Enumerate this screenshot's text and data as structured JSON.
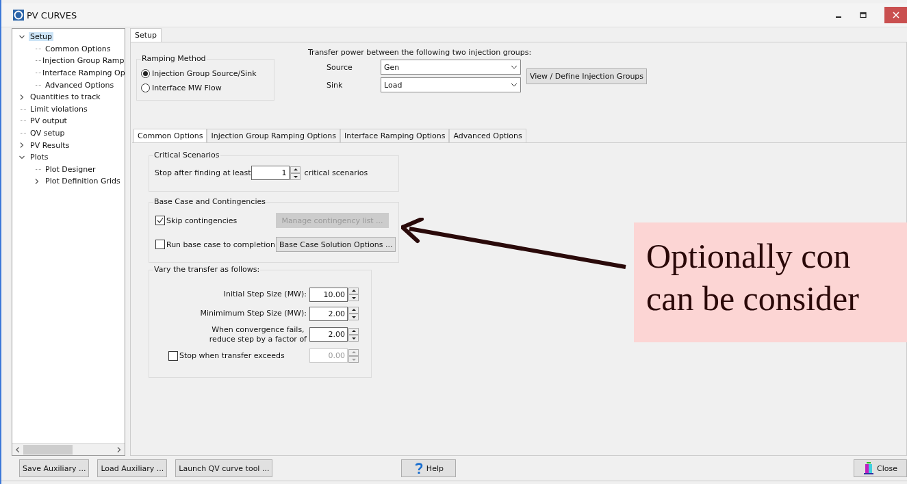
{
  "window": {
    "title": "PV CURVES"
  },
  "tree": [
    {
      "label": "Setup",
      "kind": "branch",
      "expanded": true,
      "selected": true,
      "children": [
        {
          "label": "Common Options",
          "kind": "leaf",
          "selected": false
        },
        {
          "label": "Injection Group Ramp",
          "kind": "leaf",
          "selected": false
        },
        {
          "label": "Interface Ramping Op",
          "kind": "leaf",
          "selected": false
        },
        {
          "label": "Advanced Options",
          "kind": "leaf",
          "selected": false
        }
      ]
    },
    {
      "label": "Quantities to track",
      "kind": "branch",
      "expanded": false,
      "selected": false
    },
    {
      "label": "Limit violations",
      "kind": "leaf",
      "selected": false
    },
    {
      "label": "PV output",
      "kind": "leaf",
      "selected": false
    },
    {
      "label": "QV setup",
      "kind": "leaf",
      "selected": false
    },
    {
      "label": "PV Results",
      "kind": "branch",
      "expanded": false,
      "selected": false
    },
    {
      "label": "Plots",
      "kind": "branch",
      "expanded": true,
      "selected": false,
      "children": [
        {
          "label": "Plot Designer",
          "kind": "leaf",
          "selected": false
        },
        {
          "label": "Plot Definition Grids",
          "kind": "branch",
          "expanded": false,
          "selected": false
        }
      ]
    }
  ],
  "top_tabs": [
    {
      "label": "Setup",
      "selected": true
    }
  ],
  "ramping_method": {
    "title": "Ramping Method",
    "options": [
      {
        "label": "Injection Group Source/Sink",
        "selected": true
      },
      {
        "label": "Interface MW Flow",
        "selected": false
      }
    ]
  },
  "transfer": {
    "heading": "Transfer power between the following two injection groups:",
    "fields": [
      {
        "label": "Source",
        "value": "Gen"
      },
      {
        "label": "Sink",
        "value": "Load"
      }
    ],
    "button": "View / Define Injection Groups"
  },
  "option_tabs": [
    {
      "label": "Common Options",
      "selected": true
    },
    {
      "label": "Injection Group Ramping Options",
      "selected": false
    },
    {
      "label": "Interface Ramping Options",
      "selected": false
    },
    {
      "label": "Advanced Options",
      "selected": false
    }
  ],
  "critical": {
    "title": "Critical Scenarios",
    "prefix": "Stop after finding at least",
    "value": "1",
    "suffix": "critical scenarios"
  },
  "base_case": {
    "title": "Base Case and Contingencies",
    "rows": [
      {
        "label": "Skip contingencies",
        "checked": true,
        "button": "Manage contingency list ...",
        "button_disabled": true
      },
      {
        "label": "Run base case to completion",
        "checked": false,
        "button": "Base Case Solution Options ...",
        "button_disabled": false
      }
    ]
  },
  "vary": {
    "title": "Vary the transfer as follows:",
    "rows": [
      {
        "kind": "field",
        "label": "Initial Step Size (MW):",
        "value": "10.00",
        "disabled": false
      },
      {
        "kind": "field",
        "label": "Minimimum Step Size (MW):",
        "value": "2.00",
        "disabled": false
      },
      {
        "kind": "field",
        "label": "When convergence fails,\nreduce step by a factor of",
        "value": "2.00",
        "disabled": false
      },
      {
        "kind": "check",
        "label": "Stop when transfer exceeds",
        "checked": false,
        "value": "0.00",
        "disabled": true
      }
    ]
  },
  "bottom_buttons": [
    {
      "label": "Save Auxiliary ...",
      "kind": "plain"
    },
    {
      "label": "Load  Auxiliary ...",
      "kind": "plain"
    },
    {
      "label": "Launch QV curve tool ...",
      "kind": "plain"
    },
    {
      "label": "Help",
      "kind": "help"
    },
    {
      "label": "Close",
      "kind": "close"
    }
  ],
  "callout": {
    "lines": [
      "Optionally con",
      "can be consider"
    ]
  }
}
